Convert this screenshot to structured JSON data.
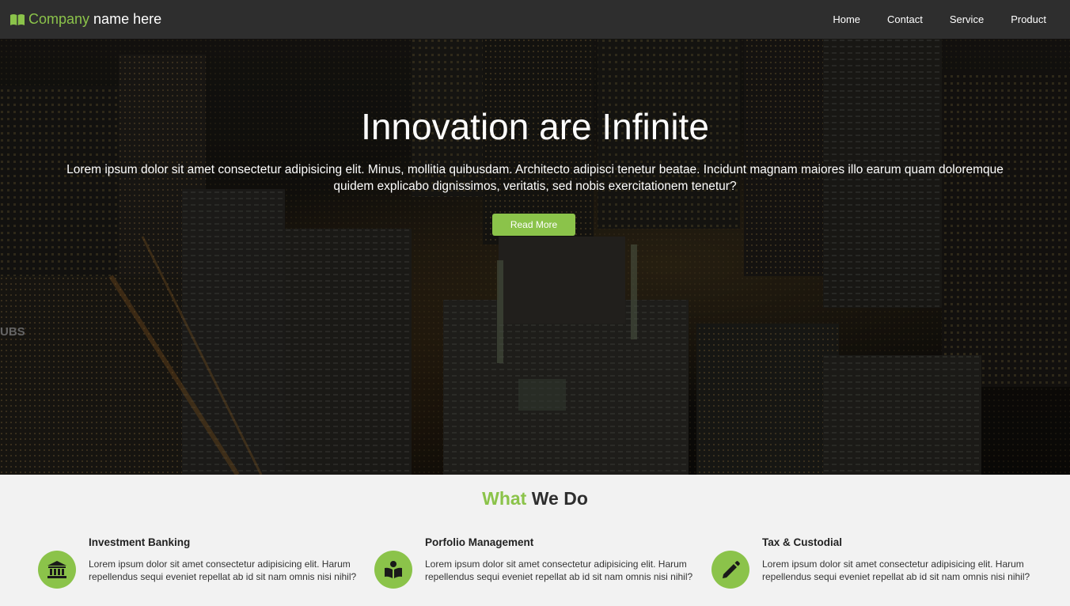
{
  "navbar": {
    "brand_green": "Company",
    "brand_white": "name here",
    "links": [
      "Home",
      "Contact",
      "Service",
      "Product"
    ]
  },
  "hero": {
    "title": "Innovation are Infinite",
    "text": "Lorem ipsum dolor sit amet consectetur adipisicing elit. Minus, mollitia quibusdam. Architecto adipisci tenetur beatae. Incidunt magnam maiores illo earum quam doloremque quidem explicabo dignissimos, veritatis, sed nobis exercitationem tenetur?",
    "button_label": "Read More",
    "sign_text": "UBS"
  },
  "section": {
    "title_green": "What",
    "title_dark": "We Do"
  },
  "services": [
    {
      "title": "Investment Banking",
      "text": "Lorem ipsum dolor sit amet consectetur adipisicing elit. Harum repellendus sequi eveniet repellat ab id sit nam omnis nisi nihil?",
      "icon": "bank-icon"
    },
    {
      "title": "Porfolio Management",
      "text": "Lorem ipsum dolor sit amet consectetur adipisicing elit. Harum repellendus sequi eveniet repellat ab id sit nam omnis nisi nihil?",
      "icon": "book-reader-icon"
    },
    {
      "title": "Tax & Custodial",
      "text": "Lorem ipsum dolor sit amet consectetur adipisicing elit. Harum repellendus sequi eveniet repellat ab id sit nam omnis nisi nihil?",
      "icon": "pencil-icon"
    }
  ],
  "colors": {
    "accent": "#8bc34a",
    "navbar": "#2e2e2e",
    "section_bg": "#f2f2f2"
  }
}
